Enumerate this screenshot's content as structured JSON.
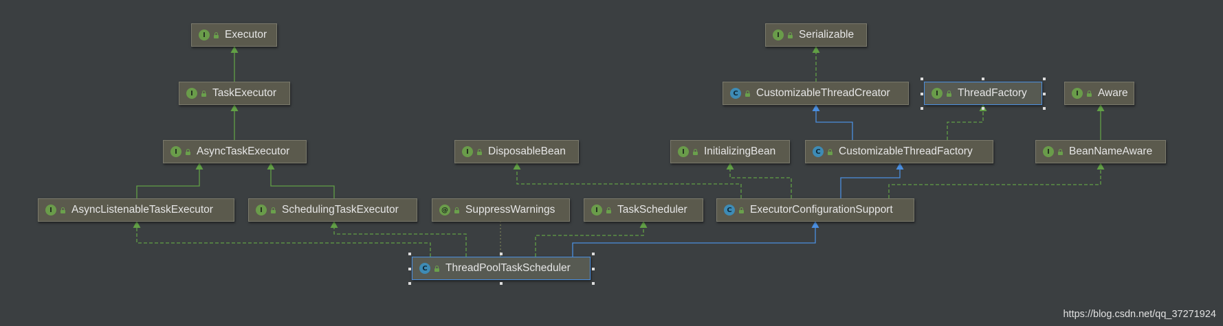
{
  "nodes": [
    {
      "id": "executor",
      "name": "Executor",
      "kind": "interface",
      "kind_letter": "I"
    },
    {
      "id": "serializable",
      "name": "Serializable",
      "kind": "interface",
      "kind_letter": "I"
    },
    {
      "id": "task-executor",
      "name": "TaskExecutor",
      "kind": "interface",
      "kind_letter": "I"
    },
    {
      "id": "customizable-thread-creator",
      "name": "CustomizableThreadCreator",
      "kind": "class",
      "kind_letter": "C"
    },
    {
      "id": "thread-factory",
      "name": "ThreadFactory",
      "kind": "interface",
      "kind_letter": "I",
      "selected": true
    },
    {
      "id": "aware",
      "name": "Aware",
      "kind": "interface",
      "kind_letter": "I"
    },
    {
      "id": "async-task-executor",
      "name": "AsyncTaskExecutor",
      "kind": "interface",
      "kind_letter": "I"
    },
    {
      "id": "disposable-bean",
      "name": "DisposableBean",
      "kind": "interface",
      "kind_letter": "I"
    },
    {
      "id": "initializing-bean",
      "name": "InitializingBean",
      "kind": "interface",
      "kind_letter": "I"
    },
    {
      "id": "customizable-thread-factory",
      "name": "CustomizableThreadFactory",
      "kind": "class",
      "kind_letter": "C"
    },
    {
      "id": "bean-name-aware",
      "name": "BeanNameAware",
      "kind": "interface",
      "kind_letter": "I"
    },
    {
      "id": "async-listenable-task-executor",
      "name": "AsyncListenableTaskExecutor",
      "kind": "interface",
      "kind_letter": "I"
    },
    {
      "id": "scheduling-task-executor",
      "name": "SchedulingTaskExecutor",
      "kind": "interface",
      "kind_letter": "I"
    },
    {
      "id": "suppress-warnings",
      "name": "SuppressWarnings",
      "kind": "annotation",
      "kind_letter": "@"
    },
    {
      "id": "task-scheduler",
      "name": "TaskScheduler",
      "kind": "interface",
      "kind_letter": "I"
    },
    {
      "id": "executor-configuration-support",
      "name": "ExecutorConfigurationSupport",
      "kind": "class",
      "kind_letter": "C",
      "abstract": true
    },
    {
      "id": "thread-pool-task-scheduler",
      "name": "ThreadPoolTaskScheduler",
      "kind": "class",
      "kind_letter": "C",
      "selected": true
    }
  ],
  "edges": [
    {
      "from": "task-executor",
      "to": "executor",
      "type": "extends-interface"
    },
    {
      "from": "async-task-executor",
      "to": "task-executor",
      "type": "extends-interface"
    },
    {
      "from": "async-listenable-task-executor",
      "to": "async-task-executor",
      "type": "extends-interface"
    },
    {
      "from": "scheduling-task-executor",
      "to": "async-task-executor",
      "type": "extends-interface"
    },
    {
      "from": "customizable-thread-creator",
      "to": "serializable",
      "type": "implements"
    },
    {
      "from": "customizable-thread-factory",
      "to": "customizable-thread-creator",
      "type": "extends-class"
    },
    {
      "from": "customizable-thread-factory",
      "to": "thread-factory",
      "type": "implements"
    },
    {
      "from": "bean-name-aware",
      "to": "aware",
      "type": "extends-interface"
    },
    {
      "from": "executor-configuration-support",
      "to": "customizable-thread-factory",
      "type": "extends-class"
    },
    {
      "from": "executor-configuration-support",
      "to": "disposable-bean",
      "type": "implements"
    },
    {
      "from": "executor-configuration-support",
      "to": "initializing-bean",
      "type": "implements"
    },
    {
      "from": "executor-configuration-support",
      "to": "bean-name-aware",
      "type": "implements"
    },
    {
      "from": "thread-pool-task-scheduler",
      "to": "async-listenable-task-executor",
      "type": "implements"
    },
    {
      "from": "thread-pool-task-scheduler",
      "to": "scheduling-task-executor",
      "type": "implements"
    },
    {
      "from": "thread-pool-task-scheduler",
      "to": "task-scheduler",
      "type": "implements"
    },
    {
      "from": "thread-pool-task-scheduler",
      "to": "executor-configuration-support",
      "type": "extends-class"
    },
    {
      "from": "thread-pool-task-scheduler",
      "to": "suppress-warnings",
      "type": "annotated-by"
    }
  ],
  "colors": {
    "background": "#3b3f41",
    "extends_interface": "#62a046",
    "implements": "#62a046",
    "extends_class": "#4b8fe0",
    "annotation_link": "#8a8f5a"
  },
  "watermark": "https://blog.csdn.net/qq_37271924"
}
